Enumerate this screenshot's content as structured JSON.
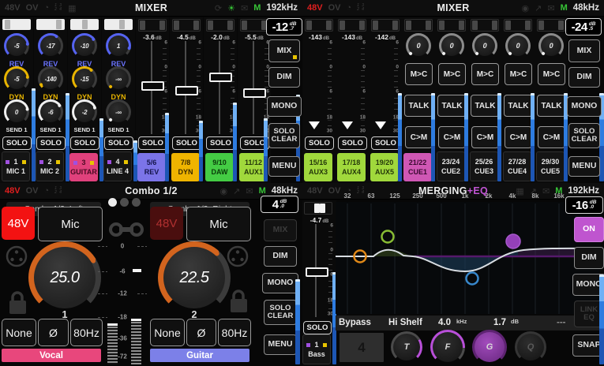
{
  "colors": {
    "accent_blue": "#5563f0",
    "accent_yellow": "#e8b400",
    "accent_orange": "#d2641e",
    "meter_blue": "#2e7ce0",
    "magenta": "#bf55cf",
    "label_green": "#a0d83c",
    "label_pink": "#cf57b4",
    "label_violet": "#7b74e8",
    "label_amber": "#efb400",
    "label_daw_green": "#44cc44",
    "guitar_pink": "#e0417c",
    "vocal_pink": "#e8477c",
    "guitar_banner": "#7c80e8",
    "p48_red": "#f31212"
  },
  "icons": {
    "clock": "◔",
    "grid": "▦",
    "recycle": "⟳",
    "lamp": "☀",
    "mail": "✉",
    "buoy": "◉",
    "share": "↗",
    "mini1": "1 3",
    "mini2": "2 4"
  },
  "tl": {
    "h48": "48V",
    "hov": "OV",
    "title": "MIXER",
    "m": "M",
    "rate": "192kHz",
    "solo": "SOLO",
    "knob_labels": [
      "REV",
      "DYN",
      "SEND 1"
    ],
    "inputs": [
      {
        "rev": "-5",
        "dyn": "-5",
        "send": "0",
        "num": "1",
        "name": "MIC 1"
      },
      {
        "rev": "-17",
        "dyn": "-140",
        "send": "-6",
        "num": "2",
        "name": "MIC 2"
      },
      {
        "rev": "-10",
        "dyn": "-15",
        "send": "-2",
        "num": "3",
        "name": "GUITAR"
      },
      {
        "rev": "1",
        "dyn": "-∞",
        "send": "-∞",
        "num": "4",
        "name": "LINE 4"
      }
    ],
    "outputs": [
      {
        "db": "-3.6",
        "unit": "dB",
        "pair": "5/6",
        "name": "REV"
      },
      {
        "db": "-4.5",
        "unit": "dB",
        "pair": "7/8",
        "name": "DYN"
      },
      {
        "db": "-2.0",
        "unit": "dB",
        "pair": "9/10",
        "name": "DAW"
      },
      {
        "db": "-5.5",
        "unit": "dB",
        "pair": "11/12",
        "name": "AUX1"
      }
    ],
    "scale": [
      "6",
      "0",
      "6",
      "18",
      "30"
    ],
    "display": {
      "val": "-12",
      "unit": "dB",
      "frac": ".7"
    },
    "buttons": {
      "mix": "MIX",
      "dim": "DIM",
      "mono": "MONO",
      "soloclear": "SOLO CLEAR",
      "menu": "MENU"
    }
  },
  "tr": {
    "h48": "48V",
    "hov": "OV",
    "title": "MIXER",
    "m": "M",
    "rate": "48kHz",
    "solo": "SOLO",
    "aux": [
      {
        "db": "-143",
        "unit": "dB",
        "pair": "15/16",
        "name": "AUX3"
      },
      {
        "db": "-143",
        "unit": "dB",
        "pair": "17/18",
        "name": "AUX4"
      },
      {
        "db": "-142",
        "unit": "dB",
        "pair": "19/20",
        "name": "AUX5"
      }
    ],
    "cues": [
      {
        "knob": "0",
        "pair": "21/22",
        "name": "CUE1"
      },
      {
        "knob": "0",
        "pair": "23/24",
        "name": "CUE2"
      },
      {
        "knob": "0",
        "pair": "25/26",
        "name": "CUE3"
      },
      {
        "knob": "0",
        "pair": "27/28",
        "name": "CUE4"
      },
      {
        "knob": "0",
        "pair": "29/30",
        "name": "CUE5"
      }
    ],
    "cue_buttons": [
      "M>C",
      "TALK",
      "C>M"
    ],
    "scale": [
      "6",
      "0",
      "6",
      "18",
      "30"
    ],
    "display": {
      "val": "-24",
      "unit": "dB",
      "frac": ".5"
    },
    "buttons": {
      "mix": "MIX",
      "dim": "DIM",
      "mono": "MONO",
      "soloclear": "SOLO CLEAR",
      "menu": "MENU"
    }
  },
  "bl": {
    "h48": "48V",
    "hov": "OV",
    "title": "Combo 1/2",
    "m": "M",
    "rate": "48kHz",
    "left": {
      "title": "Combo 1/2: Left",
      "p48": "48V",
      "src": "Mic",
      "gain": "25.0",
      "num": "1",
      "b1": "None",
      "b2": "Ø",
      "b3": "80Hz",
      "banner": "Vocal"
    },
    "right": {
      "title": "Combo 1/2: Right",
      "p48": "48V",
      "src": "Mic",
      "gain": "22.5",
      "num": "2",
      "b1": "None",
      "b2": "Ø",
      "b3": "80Hz",
      "banner": "Guitar"
    },
    "meter_scale": [
      "0",
      "-6",
      "-12",
      "-18",
      "-36",
      "-72"
    ],
    "display": {
      "val": "4",
      "unit": "dB",
      "frac": ".0"
    },
    "buttons": {
      "mix": "MIX",
      "dim": "DIM",
      "mono": "MONO",
      "soloclear": "SOLO CLEAR",
      "menu": "MENU"
    }
  },
  "br": {
    "h48": "48V",
    "hov": "OV",
    "title1": "MERGING",
    "title2": "+EQ",
    "m": "M",
    "rate": "192kHz",
    "strip": {
      "db": "-4.7",
      "unit": "dB",
      "solo": "SOLO",
      "num": "1",
      "name": "Bass"
    },
    "scale": [
      "6",
      "0",
      "6",
      "18",
      "30"
    ],
    "freqs": [
      "32",
      "63",
      "125",
      "250",
      "500",
      "1k",
      "2k",
      "4k",
      "8k",
      "16k"
    ],
    "controls": {
      "bypass": "Bypass",
      "type": "Hi Shelf",
      "freq": "4.0",
      "freq_unit": "kHz",
      "gain": "1.7",
      "gain_unit": "dB",
      "q": "---",
      "band": "4",
      "k1": "T",
      "k2": "F",
      "k3": "G",
      "k4": "Q"
    },
    "display": {
      "val": "-16",
      "unit": "dB",
      "frac": ".0"
    },
    "buttons": {
      "on": "ON",
      "dim": "DIM",
      "mono": "MONO",
      "linkeq": "LINK EQ",
      "snap": "SNAP"
    }
  }
}
